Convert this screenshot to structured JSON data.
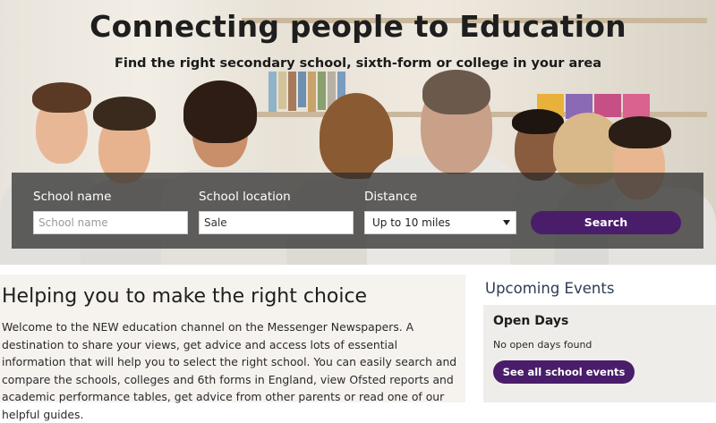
{
  "hero": {
    "title": "Connecting people to Education",
    "subtitle": "Find the right secondary school, sixth-form or college in your area"
  },
  "search": {
    "school_name_label": "School name",
    "school_name_placeholder": "School name",
    "school_name_value": "",
    "location_label": "School location",
    "location_value": "Sale",
    "distance_label": "Distance",
    "distance_value": "Up to 10 miles",
    "button_label": "Search"
  },
  "main": {
    "title": "Helping you to make the right choice",
    "text": "Welcome to the NEW education channel on the Messenger Newspapers. A destination to share your views, get advice and access lots of essential information that will help you to select the right school. You can easily search and compare the schools, colleges and 6th forms in England, view Ofsted reports and academic performance tables, get advice from other parents or read one of our helpful guides."
  },
  "events": {
    "title": "Upcoming Events",
    "box_title": "Open Days",
    "box_text": "No open days found",
    "button_label": "See all school events"
  },
  "colors": {
    "accent": "#4a1d6b",
    "events_title": "#2d3b55",
    "panel": "#282828"
  }
}
